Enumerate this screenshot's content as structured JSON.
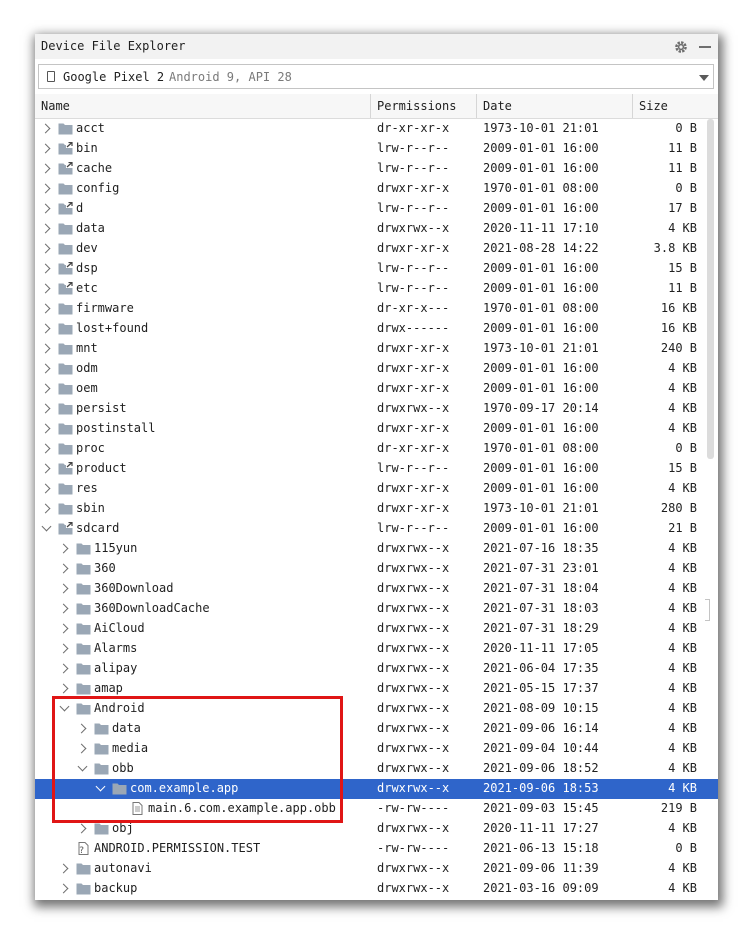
{
  "window": {
    "title": "Device File Explorer"
  },
  "device": {
    "name": "Google Pixel 2",
    "details": "Android 9, API 28"
  },
  "columns": {
    "name": "Name",
    "permissions": "Permissions",
    "date": "Date",
    "size": "Size"
  },
  "colors": {
    "selection": "#2f65ca",
    "folder": "#9aa7b5",
    "highlight_box": "#e01515"
  },
  "rows": [
    {
      "name": "acct",
      "permissions": "dr-xr-xr-x",
      "date": "1973-10-01 21:01",
      "size": "0 B",
      "depth": 0,
      "type": "folder",
      "expand": "collapsed"
    },
    {
      "name": "bin",
      "permissions": "lrw-r--r--",
      "date": "2009-01-01 16:00",
      "size": "11 B",
      "depth": 0,
      "type": "link",
      "expand": "collapsed"
    },
    {
      "name": "cache",
      "permissions": "lrw-r--r--",
      "date": "2009-01-01 16:00",
      "size": "11 B",
      "depth": 0,
      "type": "link",
      "expand": "collapsed"
    },
    {
      "name": "config",
      "permissions": "drwxr-xr-x",
      "date": "1970-01-01 08:00",
      "size": "0 B",
      "depth": 0,
      "type": "folder",
      "expand": "collapsed"
    },
    {
      "name": "d",
      "permissions": "lrw-r--r--",
      "date": "2009-01-01 16:00",
      "size": "17 B",
      "depth": 0,
      "type": "link",
      "expand": "collapsed"
    },
    {
      "name": "data",
      "permissions": "drwxrwx--x",
      "date": "2020-11-11 17:10",
      "size": "4 KB",
      "depth": 0,
      "type": "folder",
      "expand": "collapsed"
    },
    {
      "name": "dev",
      "permissions": "drwxr-xr-x",
      "date": "2021-08-28 14:22",
      "size": "3.8 KB",
      "depth": 0,
      "type": "folder",
      "expand": "collapsed"
    },
    {
      "name": "dsp",
      "permissions": "lrw-r--r--",
      "date": "2009-01-01 16:00",
      "size": "15 B",
      "depth": 0,
      "type": "link",
      "expand": "collapsed"
    },
    {
      "name": "etc",
      "permissions": "lrw-r--r--",
      "date": "2009-01-01 16:00",
      "size": "11 B",
      "depth": 0,
      "type": "link",
      "expand": "collapsed"
    },
    {
      "name": "firmware",
      "permissions": "dr-xr-x---",
      "date": "1970-01-01 08:00",
      "size": "16 KB",
      "depth": 0,
      "type": "folder",
      "expand": "collapsed"
    },
    {
      "name": "lost+found",
      "permissions": "drwx------",
      "date": "2009-01-01 16:00",
      "size": "16 KB",
      "depth": 0,
      "type": "folder",
      "expand": "collapsed"
    },
    {
      "name": "mnt",
      "permissions": "drwxr-xr-x",
      "date": "1973-10-01 21:01",
      "size": "240 B",
      "depth": 0,
      "type": "folder",
      "expand": "collapsed"
    },
    {
      "name": "odm",
      "permissions": "drwxr-xr-x",
      "date": "2009-01-01 16:00",
      "size": "4 KB",
      "depth": 0,
      "type": "folder",
      "expand": "collapsed"
    },
    {
      "name": "oem",
      "permissions": "drwxr-xr-x",
      "date": "2009-01-01 16:00",
      "size": "4 KB",
      "depth": 0,
      "type": "folder",
      "expand": "collapsed"
    },
    {
      "name": "persist",
      "permissions": "drwxrwx--x",
      "date": "1970-09-17 20:14",
      "size": "4 KB",
      "depth": 0,
      "type": "folder",
      "expand": "collapsed"
    },
    {
      "name": "postinstall",
      "permissions": "drwxr-xr-x",
      "date": "2009-01-01 16:00",
      "size": "4 KB",
      "depth": 0,
      "type": "folder",
      "expand": "collapsed"
    },
    {
      "name": "proc",
      "permissions": "dr-xr-xr-x",
      "date": "1970-01-01 08:00",
      "size": "0 B",
      "depth": 0,
      "type": "folder",
      "expand": "collapsed"
    },
    {
      "name": "product",
      "permissions": "lrw-r--r--",
      "date": "2009-01-01 16:00",
      "size": "15 B",
      "depth": 0,
      "type": "link",
      "expand": "collapsed"
    },
    {
      "name": "res",
      "permissions": "drwxr-xr-x",
      "date": "2009-01-01 16:00",
      "size": "4 KB",
      "depth": 0,
      "type": "folder",
      "expand": "collapsed"
    },
    {
      "name": "sbin",
      "permissions": "drwxr-xr-x",
      "date": "1973-10-01 21:01",
      "size": "280 B",
      "depth": 0,
      "type": "folder",
      "expand": "collapsed"
    },
    {
      "name": "sdcard",
      "permissions": "lrw-r--r--",
      "date": "2009-01-01 16:00",
      "size": "21 B",
      "depth": 0,
      "type": "link",
      "expand": "expanded"
    },
    {
      "name": "115yun",
      "permissions": "drwxrwx--x",
      "date": "2021-07-16 18:35",
      "size": "4 KB",
      "depth": 1,
      "type": "folder",
      "expand": "collapsed"
    },
    {
      "name": "360",
      "permissions": "drwxrwx--x",
      "date": "2021-07-31 23:01",
      "size": "4 KB",
      "depth": 1,
      "type": "folder",
      "expand": "collapsed"
    },
    {
      "name": "360Download",
      "permissions": "drwxrwx--x",
      "date": "2021-07-31 18:04",
      "size": "4 KB",
      "depth": 1,
      "type": "folder",
      "expand": "collapsed"
    },
    {
      "name": "360DownloadCache",
      "permissions": "drwxrwx--x",
      "date": "2021-07-31 18:03",
      "size": "4 KB",
      "depth": 1,
      "type": "folder",
      "expand": "collapsed"
    },
    {
      "name": "AiCloud",
      "permissions": "drwxrwx--x",
      "date": "2021-07-31 18:29",
      "size": "4 KB",
      "depth": 1,
      "type": "folder",
      "expand": "collapsed"
    },
    {
      "name": "Alarms",
      "permissions": "drwxrwx--x",
      "date": "2020-11-11 17:05",
      "size": "4 KB",
      "depth": 1,
      "type": "folder",
      "expand": "collapsed"
    },
    {
      "name": "alipay",
      "permissions": "drwxrwx--x",
      "date": "2021-06-04 17:35",
      "size": "4 KB",
      "depth": 1,
      "type": "folder",
      "expand": "collapsed"
    },
    {
      "name": "amap",
      "permissions": "drwxrwx--x",
      "date": "2021-05-15 17:37",
      "size": "4 KB",
      "depth": 1,
      "type": "folder",
      "expand": "collapsed"
    },
    {
      "name": "Android",
      "permissions": "drwxrwx--x",
      "date": "2021-08-09 10:15",
      "size": "4 KB",
      "depth": 1,
      "type": "folder",
      "expand": "expanded"
    },
    {
      "name": "data",
      "permissions": "drwxrwx--x",
      "date": "2021-09-06 16:14",
      "size": "4 KB",
      "depth": 2,
      "type": "folder",
      "expand": "collapsed"
    },
    {
      "name": "media",
      "permissions": "drwxrwx--x",
      "date": "2021-09-04 10:44",
      "size": "4 KB",
      "depth": 2,
      "type": "folder",
      "expand": "collapsed"
    },
    {
      "name": "obb",
      "permissions": "drwxrwx--x",
      "date": "2021-09-06 18:52",
      "size": "4 KB",
      "depth": 2,
      "type": "folder",
      "expand": "expanded"
    },
    {
      "name": "com.example.app",
      "permissions": "drwxrwx--x",
      "date": "2021-09-06 18:53",
      "size": "4 KB",
      "depth": 3,
      "type": "folder",
      "expand": "expanded",
      "selected": true
    },
    {
      "name": "main.6.com.example.app.obb",
      "permissions": "-rw-rw----",
      "date": "2021-09-03 15:45",
      "size": "219 B",
      "depth": 4,
      "type": "file",
      "expand": "none"
    },
    {
      "name": "obj",
      "permissions": "drwxrwx--x",
      "date": "2020-11-11 17:27",
      "size": "4 KB",
      "depth": 2,
      "type": "folder",
      "expand": "collapsed"
    },
    {
      "name": "ANDROID.PERMISSION.TEST",
      "permissions": "-rw-rw----",
      "date": "2021-06-13 15:18",
      "size": "0 B",
      "depth": 1,
      "type": "unknown",
      "expand": "none"
    },
    {
      "name": "autonavi",
      "permissions": "drwxrwx--x",
      "date": "2021-09-06 11:39",
      "size": "4 KB",
      "depth": 1,
      "type": "folder",
      "expand": "collapsed"
    },
    {
      "name": "backup",
      "permissions": "drwxrwx--x",
      "date": "2021-03-16 09:09",
      "size": "4 KB",
      "depth": 1,
      "type": "folder",
      "expand": "collapsed"
    }
  ]
}
